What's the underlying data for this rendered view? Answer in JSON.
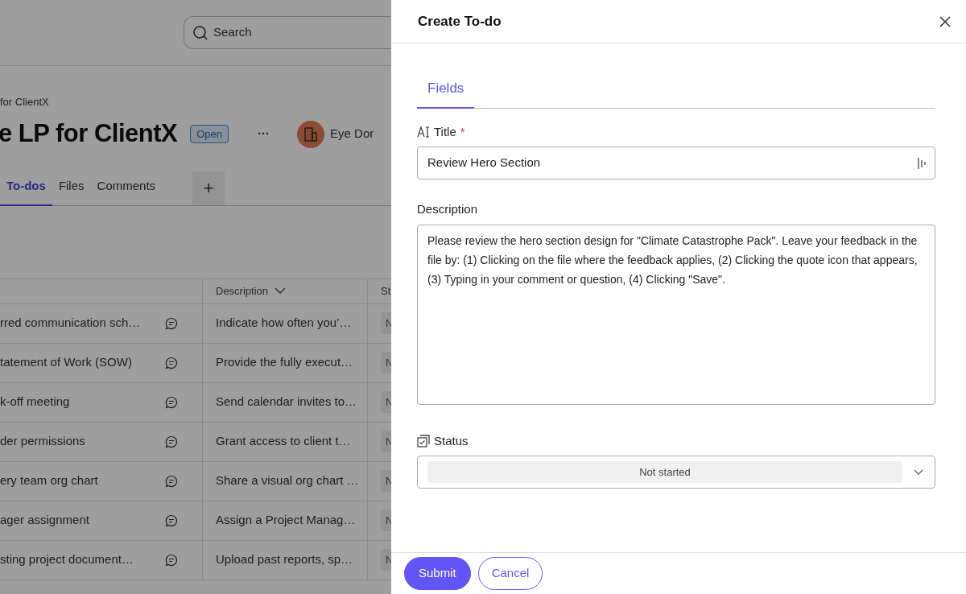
{
  "background": {
    "search": {
      "placeholder": "Search"
    },
    "breadcrumb": "for ClientX",
    "title": "e LP for ClientX",
    "status_badge": "Open",
    "more": "···",
    "owner": "Eye Dor",
    "tabs": [
      {
        "label": "To-dos",
        "selected": true
      },
      {
        "label": "Files",
        "selected": false
      },
      {
        "label": "Comments",
        "selected": false
      }
    ],
    "add_tab": "+",
    "table": {
      "columns": [
        {
          "label": "Description"
        },
        {
          "label": "St"
        }
      ],
      "rows": [
        {
          "title": "rred communication sch…",
          "description": "Indicate how often you’…",
          "status": "N"
        },
        {
          "title": "tatement of Work (SOW)",
          "description": "Provide the fully execut…",
          "status": "N"
        },
        {
          "title": "k-off meeting",
          "description": "Send calendar invites to…",
          "status": "N"
        },
        {
          "title": "der permissions",
          "description": "Grant access to client t…",
          "status": "N"
        },
        {
          "title": "ery team org chart",
          "description": "Share a visual org chart …",
          "status": "N"
        },
        {
          "title": "ager assignment",
          "description": "Assign a Project Manag…",
          "status": "N"
        },
        {
          "title": "sting project document…",
          "description": "Upload past reports, sp…",
          "status": "N"
        }
      ]
    }
  },
  "drawer": {
    "title": "Create To-do",
    "tabs": [
      {
        "label": "Fields",
        "selected": true
      }
    ],
    "fields": [
      {
        "kind": "text",
        "label": "Title",
        "required_mark": "*",
        "value": "Review Hero Section"
      },
      {
        "kind": "textarea",
        "label": "Description",
        "value": "Please review the hero section design for \"Climate Catastrophe Pack\". Leave your feedback in the file by: (1) Clicking on the file where the feedback applies, (2) Clicking the quote icon that appears, (3) Typing in your comment or question, (4) Clicking \"Save\"."
      },
      {
        "kind": "select",
        "label": "Status",
        "value": "Not started"
      }
    ],
    "buttons": [
      {
        "label": "Submit",
        "kind": "primary"
      },
      {
        "label": "Cancel",
        "kind": "secondary"
      }
    ]
  }
}
